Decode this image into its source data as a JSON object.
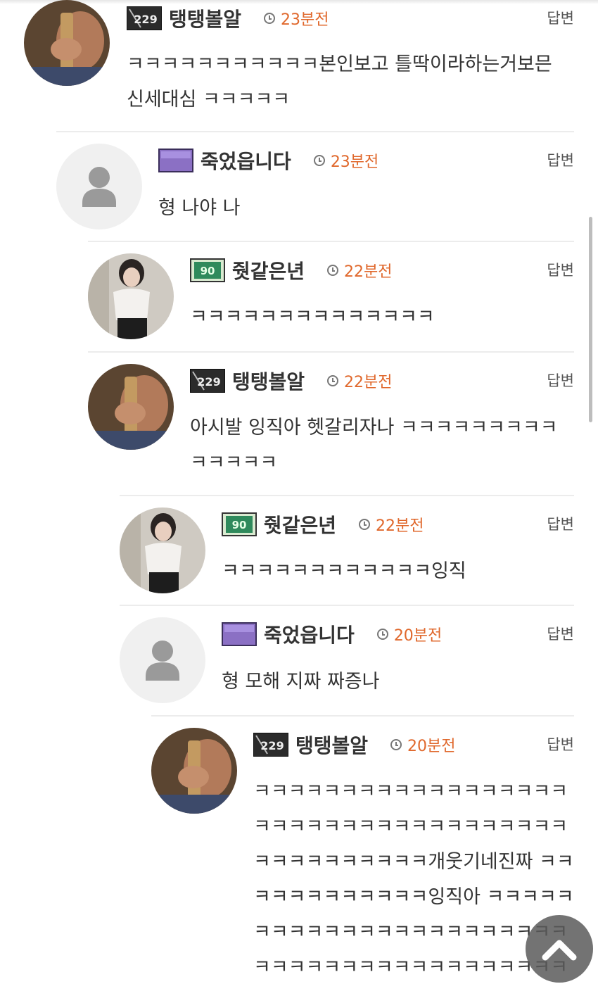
{
  "comments": [
    {
      "nick": "탱탱볼알",
      "level_badge": "229",
      "time": "23분전",
      "reply_label": "답변",
      "text": "ㅋㅋㅋㅋㅋㅋㅋㅋㅋㅋㅋ본인보고 틀딱이라하는거보믄 신세대심 ㅋㅋㅋㅋㅋ"
    },
    {
      "nick": "죽었읍니다",
      "level_badge": "",
      "time": "23분전",
      "reply_label": "답변",
      "text": "형 나야 나"
    },
    {
      "nick": "줫같은년",
      "level_badge": "90",
      "time": "22분전",
      "reply_label": "답변",
      "text": "ㅋㅋㅋㅋㅋㅋㅋㅋㅋㅋㅋㅋㅋㅋ"
    },
    {
      "nick": "탱탱볼알",
      "level_badge": "229",
      "time": "22분전",
      "reply_label": "답변",
      "text": "아시발 잉직아 헷갈리자나 ㅋㅋㅋㅋㅋㅋㅋㅋㅋㅋㅋㅋㅋㅋ"
    },
    {
      "nick": "줫같은년",
      "level_badge": "90",
      "time": "22분전",
      "reply_label": "답변",
      "text": "ㅋㅋㅋㅋㅋㅋㅋㅋㅋㅋㅋㅋ잉직"
    },
    {
      "nick": "죽었읍니다",
      "level_badge": "",
      "time": "20분전",
      "reply_label": "답변",
      "text": "형 모해 지짜 짜증나"
    },
    {
      "nick": "탱탱볼알",
      "level_badge": "229",
      "time": "20분전",
      "reply_label": "답변",
      "text": "ㅋㅋㅋㅋㅋㅋㅋㅋㅋㅋㅋㅋㅋㅋㅋㅋㅋㅋㅋㅋㅋㅋㅋㅋㅋㅋㅋㅋㅋㅋㅋㅋㅋㅋㅋㅋㅋㅋㅋㅋㅋㅋㅋㅋㅋㅋ개웃기네진짜 ㅋㅋㅋㅋㅋㅋㅋㅋㅋㅋㅋㅋ잉직아 ㅋㅋㅋㅋㅋㅋㅋㅋㅋㅋㅋㅋㅋㅋㅋㅋㅋㅋㅋㅋㅋㅋㅋㅋㅋㅋㅋㅋㅋㅋㅋㅋㅋㅋㅋㅋㅋㅋㅋㅋㅋㅋㅋㅋㅋㅋ"
    }
  ],
  "colors": {
    "time": "#e0682c",
    "divider": "#ececec",
    "fab": "#5a5a5a"
  },
  "icons": {
    "clock": "clock-icon",
    "reply": "none",
    "scroll_top": "chevron-up-icon",
    "default_avatar": "user-silhouette-icon"
  }
}
